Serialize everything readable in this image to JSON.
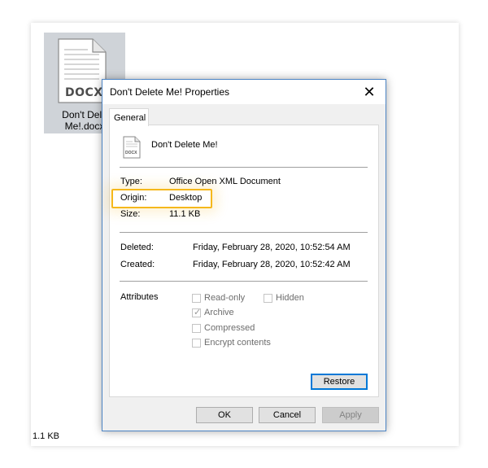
{
  "desktop": {
    "file_icon_label": "DOCX",
    "file_name_line1": "Don't Dele",
    "file_name_line2": "Me!.docx",
    "status_size": "1.1 KB"
  },
  "dialog": {
    "title": "Don't Delete Me! Properties",
    "close_glyph": "✕",
    "tab_general": "General",
    "file_icon_label": "DOCX",
    "file_name": "Don't Delete Me!",
    "type_label": "Type:",
    "type_value": "Office Open XML Document",
    "origin_label": "Origin:",
    "origin_value": "Desktop",
    "size_label": "Size:",
    "size_value": "11.1 KB",
    "deleted_label": "Deleted:",
    "deleted_value": "Friday, February 28, 2020, 10:52:54 AM",
    "created_label": "Created:",
    "created_value": "Friday, February 28, 2020, 10:52:42 AM",
    "attributes_label": "Attributes",
    "attributes": {
      "read_only": {
        "label": "Read-only",
        "checked": false
      },
      "hidden": {
        "label": "Hidden",
        "checked": false
      },
      "archive": {
        "label": "Archive",
        "checked": true
      },
      "compressed": {
        "label": "Compressed",
        "checked": false
      },
      "encrypt": {
        "label": "Encrypt contents",
        "checked": false
      }
    },
    "restore_label": "Restore",
    "ok_label": "OK",
    "cancel_label": "Cancel",
    "apply_label": "Apply"
  },
  "colors": {
    "highlight": "#f5b81c",
    "accent": "#0078d7",
    "dialog_border": "#4c84c4"
  },
  "icons": [
    "document-icon",
    "close-icon",
    "checkmark-icon"
  ]
}
